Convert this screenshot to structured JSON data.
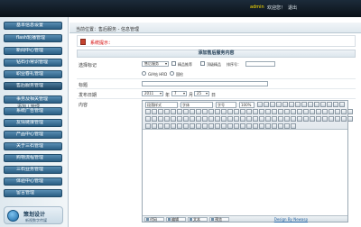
{
  "topbar": {
    "user": "admin",
    "welcome": "欢迎您！",
    "logout": "退出"
  },
  "nav": {
    "items": [
      {
        "label": "基本信息设置"
      },
      {
        "label": "flash轮播管理"
      },
      {
        "label": "新闻中心管理"
      },
      {
        "label": "钻石小常识管理"
      },
      {
        "label": "职业春礼管理"
      },
      {
        "label": "售后服务管理"
      },
      {
        "label": "事务及相关管理"
      },
      {
        "label": "系统广告管理"
      },
      {
        "label": "友情链接管理"
      },
      {
        "label": "产品中心管理"
      },
      {
        "label": "关于三石管理"
      },
      {
        "label": "购物流程管理"
      },
      {
        "label": "三石业务管理"
      },
      {
        "label": "体验中心管理"
      },
      {
        "label": "留言管理"
      }
    ],
    "sub_item": "添加 | 管理"
  },
  "badge": {
    "title": "策划设计",
    "subtitle": "新视数字传媒"
  },
  "breadcrumb": {
    "text": "当前位置：售后服务 - 信息管理"
  },
  "notice": {
    "text": "系统提示："
  },
  "form": {
    "title": "添加售后服务内容",
    "fields": {
      "category_label": "选择标记",
      "category_value": "售后服务",
      "opt_recommend": "精品推荐",
      "opt_top": "顶级精品",
      "sort_label": "排序号：",
      "opt_gia": "GIA钻 HRD",
      "opt_igi": "国检",
      "title_label": "标题",
      "date_label": "发布日期",
      "date_year": "2011",
      "date_year_unit": "年",
      "date_month": "7",
      "date_month_unit": "月",
      "date_day": "25",
      "date_day_unit": "日",
      "content_label": "内容"
    }
  },
  "editor": {
    "toolbar_selects": {
      "paragraph": "段落样式",
      "font": "字体",
      "size": "字号",
      "zoom": "100%"
    },
    "modes": [
      {
        "label": "代码"
      },
      {
        "label": "编辑"
      },
      {
        "label": "文本"
      },
      {
        "label": "预览"
      }
    ],
    "credit": "Design By Newasp"
  }
}
